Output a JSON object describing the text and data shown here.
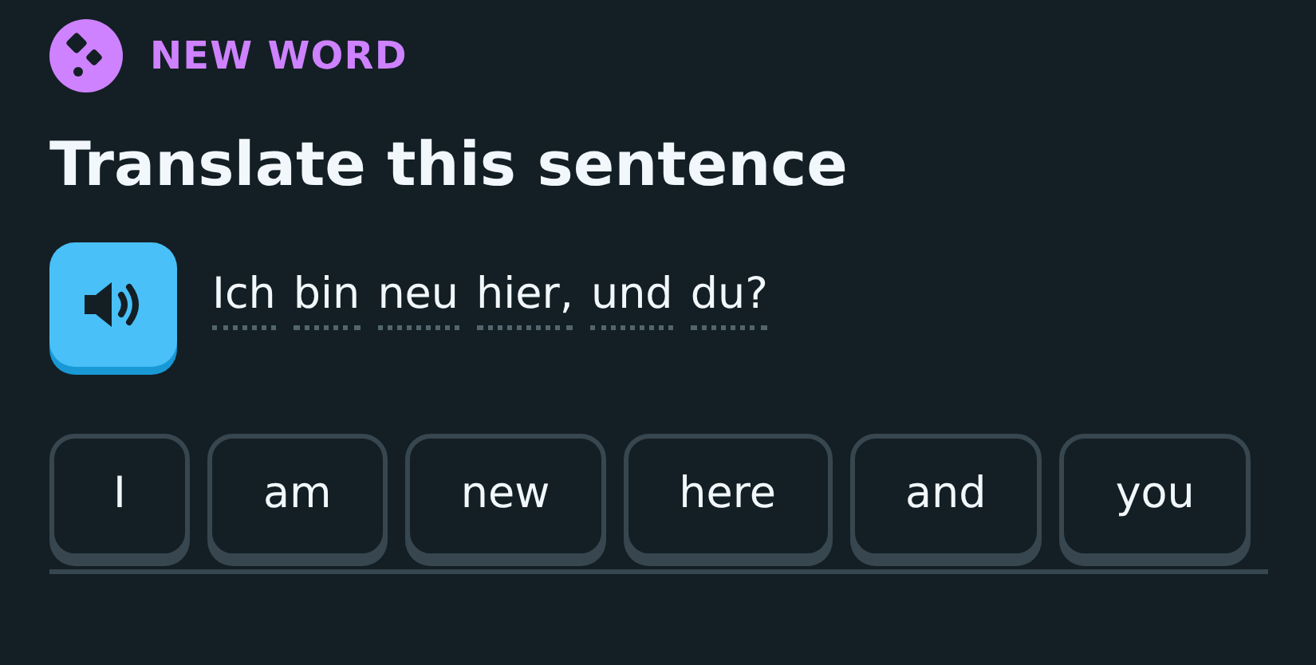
{
  "badge": {
    "label": "NEW WORD"
  },
  "title": "Translate this sentence",
  "sentence": {
    "tokens": [
      "Ich",
      "bin",
      "neu",
      "hier,",
      "und",
      "du?"
    ]
  },
  "word_bank": [
    "I",
    "am",
    "new",
    "here",
    "and",
    "you"
  ]
}
